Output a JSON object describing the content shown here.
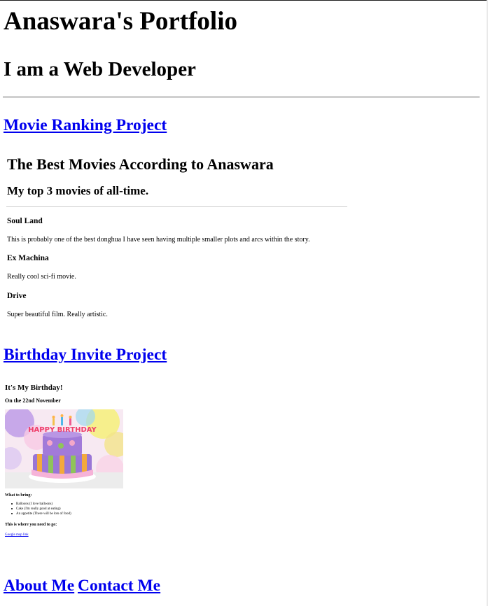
{
  "header": {
    "title": "Anaswara's Portfolio",
    "subtitle": "I am a Web Developer"
  },
  "projects": {
    "movie_link": "Movie Ranking Project",
    "birthday_link": "Birthday Invite Project"
  },
  "movie_project": {
    "heading": "The Best Movies According to Anaswara",
    "subheading": "My top 3 movies of all-time.",
    "movies": [
      {
        "title": "Soul Land",
        "description": "This is probably one of the best donghua I have seen having multiple smaller plots and arcs within the story."
      },
      {
        "title": "Ex Machina",
        "description": "Really cool sci-fi movie."
      },
      {
        "title": "Drive",
        "description": "Super beautiful film. Really artistic."
      }
    ]
  },
  "birthday_project": {
    "heading": "It's My Birthday!",
    "date": "On the 22nd November",
    "image_alt": "birthday cake",
    "cake_banner": "HAPPY BIRTHDAY",
    "bring_heading": "What to bring:",
    "bring_items": [
      "Balloons (I love balloons)",
      "Cake (I'm really good at eating)",
      "An appetite (There will be lots of food)"
    ],
    "where_heading": "This is where you need to go:",
    "map_link": "Google map link"
  },
  "footer": {
    "about_link": "About Me",
    "contact_link": "Contact Me"
  },
  "colors": {
    "link": "#0000ee",
    "text": "#000000",
    "background": "#ffffff"
  }
}
